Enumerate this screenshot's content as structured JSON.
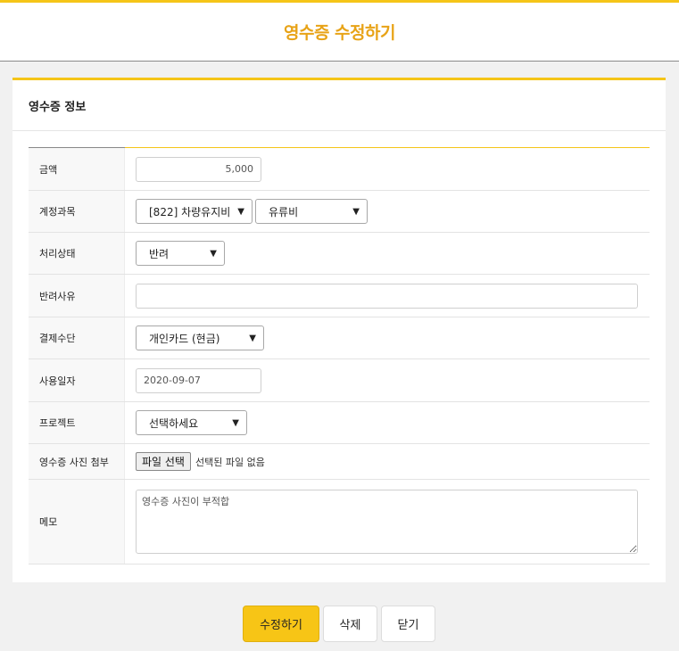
{
  "page": {
    "title": "영수증 수정하기"
  },
  "section": {
    "title": "영수증 정보"
  },
  "fields": {
    "amount": {
      "label": "금액",
      "value": "5,000"
    },
    "account": {
      "label": "계정과목",
      "primary": "[822] 차량유지비",
      "secondary": "유류비"
    },
    "status": {
      "label": "처리상태",
      "value": "반려"
    },
    "reject_reason": {
      "label": "반려사유",
      "value": ""
    },
    "payment": {
      "label": "결제수단",
      "value": "개인카드 (현금)"
    },
    "date": {
      "label": "사용일자",
      "value": "2020-09-07"
    },
    "project": {
      "label": "프로젝트",
      "value": "선택하세요"
    },
    "attach": {
      "label": "영수증 사진 첨부",
      "button": "파일 선택",
      "status": "선택된 파일 없음"
    },
    "memo": {
      "label": "메모",
      "value": "영수증 사진이 부적합"
    }
  },
  "buttons": {
    "save": "수정하기",
    "delete": "삭제",
    "close": "닫기"
  },
  "colors": {
    "accent": "#f5c518",
    "title": "#e8a317"
  }
}
